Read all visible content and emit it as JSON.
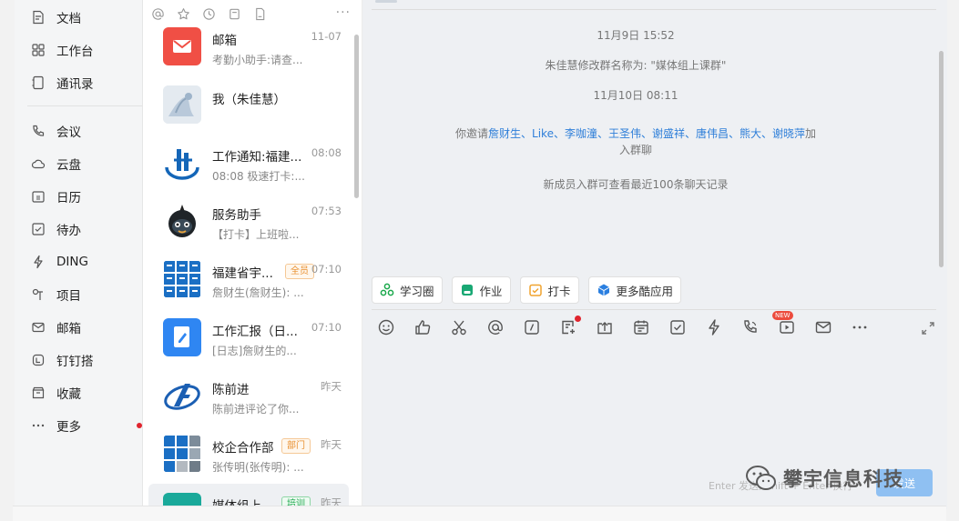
{
  "sidebar": {
    "items": [
      {
        "label": "文档"
      },
      {
        "label": "工作台"
      },
      {
        "label": "通讯录"
      },
      {
        "label": "会议"
      },
      {
        "label": "云盘"
      },
      {
        "label": "日历"
      },
      {
        "label": "待办"
      },
      {
        "label": "DING"
      },
      {
        "label": "项目"
      },
      {
        "label": "邮箱"
      },
      {
        "label": "钉钉搭"
      },
      {
        "label": "收藏"
      },
      {
        "label": "更多"
      }
    ]
  },
  "conversations": [
    {
      "name": "邮箱",
      "preview": "考勤小助手:请查...",
      "time": "11-07"
    },
    {
      "name": "我（朱佳慧）",
      "preview": "",
      "time": ""
    },
    {
      "name": "工作通知:福建...",
      "preview": "08:08 极速打卡:...",
      "time": "08:08"
    },
    {
      "name": "服务助手",
      "preview": "【打卡】上班啦...",
      "time": "07:53"
    },
    {
      "name": "福建省宇...",
      "preview": "詹财生(詹财生): ...",
      "time": "07:10",
      "tag": "全员"
    },
    {
      "name": "工作汇报（日...",
      "preview": "[日志]詹财生的...",
      "time": "07:10"
    },
    {
      "name": "陈前进",
      "preview": "陈前进评论了你...",
      "time": "昨天"
    },
    {
      "name": "校企合作部",
      "preview": "张传明(张传明): ...",
      "time": "昨天",
      "tag": "部门"
    },
    {
      "name": "媒体组上...",
      "preview": "",
      "time": "昨天",
      "tag": "培训"
    }
  ],
  "chat": {
    "messages": {
      "time1": "11月9日 15:52",
      "rename": "朱佳慧修改群名称为: \"媒体组上课群\"",
      "time2": "11月10日 08:11",
      "invite_prefix": "你邀请",
      "invite_names": "詹财生、Like、李咖潼、王圣伟、谢盛祥、唐伟昌、熊大、谢晓萍",
      "invite_suffix1": "加",
      "invite_suffix2": "入群聊",
      "history_note": "新成员入群可查看最近100条聊天记录"
    },
    "apps": [
      {
        "label": "学习圈"
      },
      {
        "label": "作业"
      },
      {
        "label": "打卡"
      },
      {
        "label": "更多酷应用"
      }
    ],
    "new_badge": "NEW",
    "enter_hint": "Enter 发送, Shift + Enter 换行",
    "send_label": "发送"
  },
  "watermark": "攀宇信息科技",
  "colors": {
    "accent": "#2f7fd9",
    "alert": "#e0242e"
  }
}
